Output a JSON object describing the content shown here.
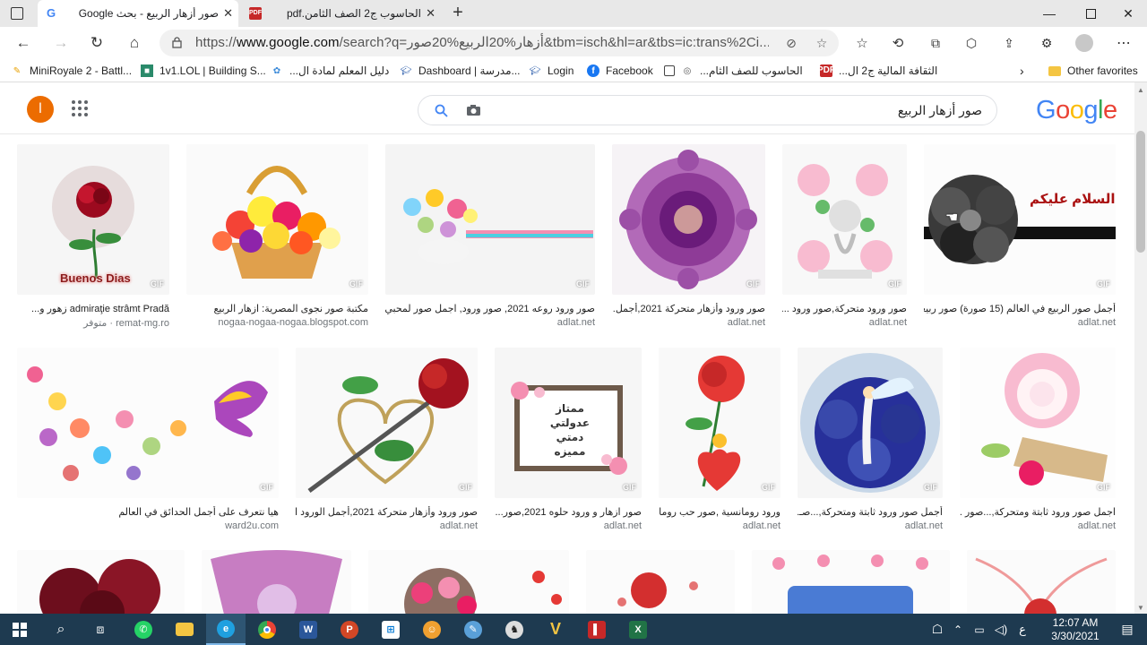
{
  "tabs": [
    {
      "title": "صور أزهار الربيع - بحث Google",
      "active": true
    },
    {
      "title": "الحاسوب ج2 الصف الثامن.pdf",
      "active": false
    }
  ],
  "address": {
    "url_prefix": "https://",
    "url_host": "www.google.com",
    "url_rest": "/search?q=أزهار%20الربيع%20صور&tbm=isch&hl=ar&tbs=ic:trans%2Ci..."
  },
  "favorites": [
    {
      "label": "MiniRoyale 2 - Battl...",
      "icon": "pencil-icon"
    },
    {
      "label": "1v1.LOL | Building S...",
      "icon": "game-icon"
    },
    {
      "label": "دليل المعلم لمادة ال...",
      "icon": "gear-icon"
    },
    {
      "label": "Dashboard | مدرسة...",
      "icon": "school-icon"
    },
    {
      "label": "Login",
      "icon": "school-icon"
    },
    {
      "label": "Facebook",
      "icon": "facebook-icon"
    },
    {
      "label": "الحاسوب للصف الثام...",
      "icon": "page-icon"
    },
    {
      "label": "الثقافة المالية ج2 ال...",
      "icon": "pdf-icon"
    },
    {
      "label": "Other favorites",
      "icon": "folder-icon"
    }
  ],
  "google": {
    "avatar_letter": "ا",
    "query": "صور أزهار الربيع",
    "logo": "Google"
  },
  "gif_badge": "GIF",
  "results_row1": [
    {
      "caption": "admiraţie strâmt Pradă زهور و...",
      "source": "remat-mg.ro · متوفر"
    },
    {
      "caption": "مكتبة صور نجوى المصرية: ازهار الربيع",
      "source": "nogaa-nogaa-nogaa.blogspot.com"
    },
    {
      "caption": "صور ورود روعه 2021, صور ورود, اجمل صور لمحبي...",
      "source": "adlat.net"
    },
    {
      "caption": "صور ورود وأزهار متحركة 2021,أجمل...",
      "source": "adlat.net"
    },
    {
      "caption": "صور ورود متحركة,صور ورود ...",
      "source": "adlat.net"
    },
    {
      "caption": "أجمل صور الربيع في العالم (15 صورة) صور ربيعي...",
      "source": "adlat.net"
    }
  ],
  "results_row2": [
    {
      "caption": "هيا نتعرف على أجمل الحدائق في العالم",
      "source": "ward2u.com"
    },
    {
      "caption": "صور ورود وأزهار متحركة 2021,أجمل الورود ا...",
      "source": "adlat.net"
    },
    {
      "caption": "صور ازهار و ورود حلوه 2021,صور...",
      "source": "adlat.net"
    },
    {
      "caption": "ورود رومانسية ,صور حب رومانـ...",
      "source": "adlat.net"
    },
    {
      "caption": "أجمل صور ورود ثابتة ومتحركة,...صـ...",
      "source": "adlat.net"
    },
    {
      "caption": "اجمل صور ورود ثابتة ومتحركة,...صور ...",
      "source": "adlat.net"
    }
  ],
  "image_texts": {
    "buenos_dias": "Buenos Dias",
    "salam": "السلام عليكم",
    "momtaz": "ممتاز عدولتي دمتي مميزه"
  },
  "clock": {
    "time": "12:07 AM",
    "date": "3/30/2021"
  },
  "tray_lang": "ع",
  "colors": {
    "accent": "#1a73e8",
    "avatar": "#ec6c00",
    "taskbar": "#1e3a50"
  }
}
